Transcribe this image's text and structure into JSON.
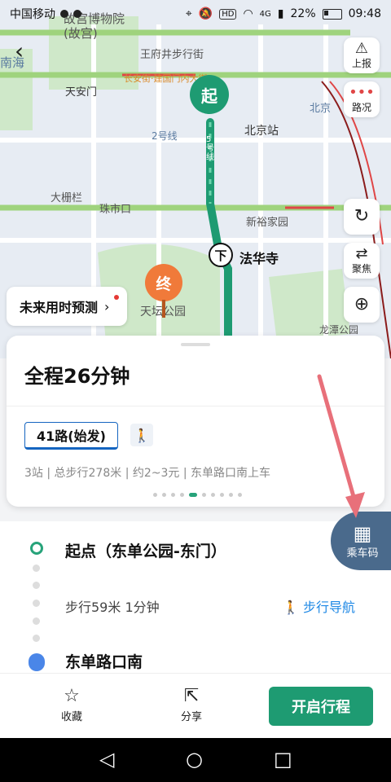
{
  "status": {
    "carrier": "中国移动",
    "battery": "22%",
    "time": "09:48",
    "net": "4G",
    "hd": "HD"
  },
  "map": {
    "labels": {
      "forbidden_city": "故宫博物院(故宫)",
      "nanhai": "南海",
      "tiananmen": "天安门",
      "wangfujing": "王府井步行街",
      "chang_an": "长安街·建国门内大街",
      "beijing_station": "北京站",
      "line2": "2号线",
      "line5": "5号线",
      "dashilan": "大栅栏",
      "zhushikou": "珠市口",
      "xinyu": "新裕家园",
      "tiantan": "天坛公园",
      "longtan": "龙潭公园",
      "fahua": "法华寺",
      "beijing_east": "北京"
    },
    "marker_start": "起",
    "marker_end": "终",
    "marker_getoff": "下"
  },
  "right_buttons": {
    "report": "上报",
    "traffic": "路况",
    "focus": "聚焦"
  },
  "predict": {
    "label": "未来用时预测",
    "chevron": "›"
  },
  "card": {
    "title": "全程26分钟",
    "route_tag": "41路(始发)",
    "summary": "3站 | 总步行278米 | 约2~3元 | 东单路口南上车"
  },
  "qr": {
    "label": "乘车码"
  },
  "steps": {
    "start_title": "起点（东单公园-东门）",
    "walk_text": "步行59米 1分钟",
    "walk_nav": "步行导航",
    "stop_title": "东单路口南"
  },
  "bottom": {
    "favorite": "收藏",
    "share": "分享",
    "go": "开启行程"
  },
  "colors": {
    "accent": "#1e9b72",
    "route_blue": "#1565c0",
    "link_blue": "#1e88e5",
    "qr_bg": "#4a6a8c"
  }
}
